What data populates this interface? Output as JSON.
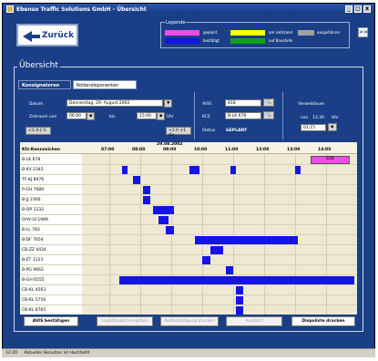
{
  "window": {
    "title": "Ebenso Traffic Solutions GmbH - Übersicht",
    "min": "_",
    "max": "□",
    "close": "x"
  },
  "back_label": "Zurück",
  "nav_next": ">>",
  "legend": {
    "title": "Legende",
    "items": [
      {
        "label": "geplant",
        "color": "#f04be8"
      },
      {
        "label": "am Leitstand",
        "color": "#ffff00"
      },
      {
        "label": "ausgefahren",
        "color": "#a0a0a0"
      },
      {
        "label": "bestätigt",
        "color": "#1414e6"
      },
      {
        "label": "auf Baustelle",
        "color": "#12a012"
      }
    ]
  },
  "group_title": "Übersicht",
  "tabs": [
    "Konsignatoren",
    "Rollendisponenten"
  ],
  "form": {
    "datum_label": "Datum",
    "datum_value": "Donnerstag, 29. August 2002",
    "zeitraum_label": "Zeitraum von",
    "von_value": "06:00",
    "bis_label": "bis",
    "bis_value": "15:00",
    "uhr": "Uhr",
    "prev_day": "<1 d-1 h",
    "next_day": "+1 h +1 d>",
    "avis_label": "AVIS",
    "avis_value": "818",
    "kfz_label": "KFZ",
    "kfz_value": "B-LK 678",
    "status_label": "Status",
    "status_value": "GEPLANT",
    "verweil_label": "Verweildauer",
    "verweil_von": "von",
    "verweil_time": "13:30",
    "verweil_uhr": "Uhr",
    "verweil_field": "01:15"
  },
  "gantt": {
    "date": "29.08.2002",
    "col_header": "Kfz-Kennzeichen",
    "hours": [
      "07:00",
      "08:00",
      "09:00",
      "10:00",
      "11:00",
      "12:00",
      "13:00",
      "14:00"
    ],
    "rows": [
      "B-LK 678",
      "B-KV 2345",
      "TF-KJ 8976",
      "P-GH 7689",
      "B-JJ 2300",
      "B-OP 1232",
      "OHV-UI 1989",
      "B-LL 783",
      "B-DF 7654",
      "CB-ZZ 4434",
      "B-ET 1123",
      "B-PG 9663",
      "B-GH 6555",
      "CB-KL 4563",
      "CB-KL 5756",
      "CB-KL 8765"
    ],
    "geplant_label": "818",
    "schedule": [
      {
        "row": 0,
        "start": "13:30",
        "end": "14:45",
        "status": "geplant"
      },
      {
        "row": 1,
        "start": "07:25",
        "end": "07:35",
        "status": "bestätigt"
      },
      {
        "row": 1,
        "start": "09:35",
        "end": "09:55",
        "status": "bestätigt"
      },
      {
        "row": 1,
        "start": "10:55",
        "end": "11:05",
        "status": "bestätigt"
      },
      {
        "row": 1,
        "start": "13:00",
        "end": "13:10",
        "status": "bestätigt"
      },
      {
        "row": 2,
        "start": "07:45",
        "end": "08:00",
        "status": "bestätigt"
      },
      {
        "row": 3,
        "start": "08:05",
        "end": "08:20",
        "status": "bestätigt"
      },
      {
        "row": 4,
        "start": "08:05",
        "end": "08:20",
        "status": "bestätigt"
      },
      {
        "row": 5,
        "start": "08:25",
        "end": "09:05",
        "status": "bestätigt"
      },
      {
        "row": 6,
        "start": "08:35",
        "end": "08:55",
        "status": "bestätigt"
      },
      {
        "row": 7,
        "start": "08:50",
        "end": "09:05",
        "status": "bestätigt"
      },
      {
        "row": 8,
        "start": "09:45",
        "end": "13:05",
        "status": "bestätigt"
      },
      {
        "row": 9,
        "start": "10:15",
        "end": "10:40",
        "status": "bestätigt"
      },
      {
        "row": 10,
        "start": "10:00",
        "end": "10:15",
        "status": "bestätigt"
      },
      {
        "row": 11,
        "start": "10:45",
        "end": "11:00",
        "status": "bestätigt"
      },
      {
        "row": 12,
        "start": "07:20",
        "end": "14:55",
        "status": "bestätigt"
      },
      {
        "row": 13,
        "start": "11:05",
        "end": "11:20",
        "status": "bestätigt"
      },
      {
        "row": 14,
        "start": "11:05",
        "end": "11:20",
        "status": "bestätigt"
      },
      {
        "row": 15,
        "start": "11:05",
        "end": "11:20",
        "status": "bestätigt"
      }
    ]
  },
  "buttons": [
    {
      "label": "AVIS bestätigen",
      "enabled": true
    },
    {
      "label": "Logistikplatz vergeben",
      "enabled": false
    },
    {
      "label": "Avisbestätigung drucken",
      "enabled": false
    },
    {
      "label": "Ausfahrt",
      "enabled": false
    },
    {
      "label": "Dispoliste drucken",
      "enabled": true
    }
  ],
  "statusbar": {
    "time": "12:20",
    "message": "Aktueller Benutzer ist Hochtiefd"
  }
}
